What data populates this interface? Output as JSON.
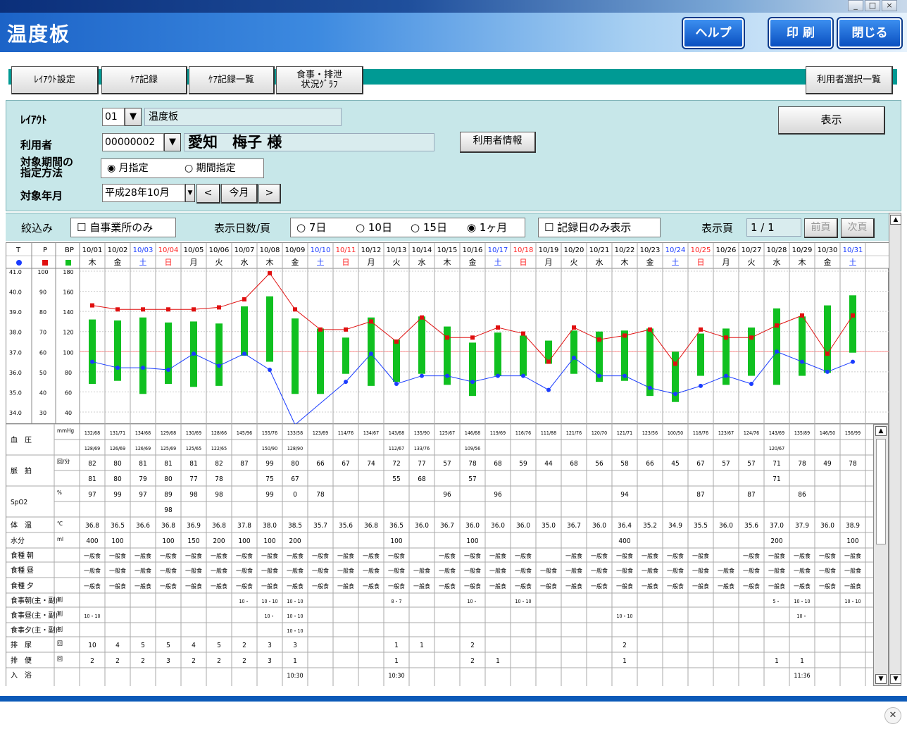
{
  "window": {
    "controls": [
      "_",
      "□",
      "×"
    ]
  },
  "header": {
    "title": "温度板",
    "help_button": "ヘルプ",
    "print_button": "印 刷",
    "close_button": "閉じる"
  },
  "tabs": [
    "ﾚｲｱｳﾄ設定",
    "ｹｱ記録",
    "ｹｱ記録一覧",
    "食事・排泄\n状況ｸﾞﾗﾌ"
  ],
  "user_select_button": "利用者選択一覧",
  "form": {
    "layout_label": "ﾚｲｱｳﾄ",
    "layout_code": "01",
    "layout_name": "温度板",
    "user_label": "利用者",
    "user_code": "00000002",
    "user_name": "愛知　梅子 様",
    "user_info_button": "利用者情報",
    "period_method_label": "対象期間の\n指定方法",
    "radio_month": "月指定",
    "radio_period": "期間指定",
    "target_month_label": "対象年月",
    "target_month_value": "平成28年10月",
    "prev_button": "<",
    "this_month_button": "今月",
    "next_button": ">",
    "display_button": "表示"
  },
  "filter": {
    "narrow_label": "絞込み",
    "own_office_only": "自事業所のみ",
    "days_per_page_label": "表示日数/頁",
    "opt_7": "7日",
    "opt_10": "10日",
    "opt_15": "15日",
    "opt_1m": "1ヶ月",
    "record_days_only": "記録日のみ表示",
    "page_label": "表示頁",
    "page_value": "1 / 1",
    "prev_page": "前頁",
    "next_page": "次頁"
  },
  "chart_data": {
    "type": "line",
    "axis_headers": {
      "t": "T",
      "p": "P",
      "bp": "BP"
    },
    "axis_t_ticks": [
      "41.0",
      "40.0",
      "39.0",
      "38.0",
      "37.0",
      "36.0",
      "35.0",
      "34.0"
    ],
    "axis_p_ticks": [
      "100",
      "90",
      "80",
      "70",
      "60",
      "50",
      "40",
      "30"
    ],
    "axis_bp_ticks": [
      "180",
      "160",
      "140",
      "120",
      "100",
      "80",
      "60",
      "40"
    ],
    "dates": [
      "10/01",
      "10/02",
      "10/03",
      "10/04",
      "10/05",
      "10/06",
      "10/07",
      "10/08",
      "10/09",
      "10/10",
      "10/11",
      "10/12",
      "10/13",
      "10/14",
      "10/15",
      "10/16",
      "10/17",
      "10/18",
      "10/19",
      "10/20",
      "10/21",
      "10/22",
      "10/23",
      "10/24",
      "10/25",
      "10/26",
      "10/27",
      "10/28",
      "10/29",
      "10/30",
      "10/31"
    ],
    "weekdays": [
      "木",
      "金",
      "土",
      "日",
      "月",
      "火",
      "水",
      "木",
      "金",
      "土",
      "日",
      "月",
      "火",
      "水",
      "木",
      "金",
      "土",
      "日",
      "月",
      "火",
      "水",
      "木",
      "金",
      "土",
      "日",
      "月",
      "火",
      "水",
      "木",
      "金",
      "土"
    ],
    "colors": {
      "saturday": "#1a3cff",
      "sunday": "#ff2020",
      "temp": "#1a3cff",
      "pulse": "#e01010",
      "bp": "#10c020",
      "baseline": "#ff9090"
    },
    "temperature": [
      36.8,
      36.5,
      36.6,
      36.8,
      36.9,
      36.8,
      37.8,
      38.0,
      38.5,
      35.7,
      35.6,
      36.8,
      36.5,
      36.0,
      36.7,
      36.0,
      36.0,
      36.0,
      35.0,
      36.7,
      36.0,
      36.4,
      35.2,
      34.9,
      35.5,
      36.0,
      35.6,
      37.0,
      37.9,
      36.0,
      38.9
    ],
    "temperature_plot": [
      36.5,
      36.2,
      36.2,
      36.1,
      36.9,
      36.3,
      36.9,
      36.1,
      33.0,
      null,
      35.5,
      36.9,
      35.4,
      35.8,
      35.8,
      35.5,
      35.8,
      35.8,
      35.1,
      36.7,
      35.8,
      35.8,
      35.2,
      34.9,
      35.3,
      35.8,
      35.4,
      37.0,
      36.5,
      36.0,
      36.5
    ],
    "pulse": [
      82,
      80,
      81,
      81,
      81,
      82,
      87,
      99,
      80,
      66,
      67,
      74,
      72,
      77,
      57,
      78,
      68,
      59,
      44,
      68,
      56,
      58,
      66,
      45,
      67,
      57,
      57,
      71,
      78,
      49,
      78
    ],
    "pulse_plot": [
      83,
      81,
      81,
      81,
      81,
      82,
      86,
      99,
      81,
      71,
      71,
      75,
      65,
      77,
      67,
      67,
      72,
      69,
      55,
      72,
      66,
      68,
      71,
      54,
      71,
      67,
      67,
      73,
      78,
      59,
      78
    ],
    "bp_high": [
      132,
      131,
      134,
      129,
      130,
      128,
      145,
      155,
      133,
      123,
      114,
      134,
      112,
      135,
      125,
      109,
      119,
      116,
      111,
      121,
      120,
      121,
      123,
      100,
      118,
      123,
      124,
      143,
      135,
      146,
      156
    ],
    "bp_low": [
      68,
      71,
      58,
      68,
      65,
      66,
      96,
      90,
      58,
      58,
      78,
      66,
      70,
      78,
      67,
      56,
      76,
      76,
      88,
      78,
      70,
      71,
      56,
      50,
      76,
      67,
      76,
      67,
      76,
      79,
      99
    ],
    "bp_high_text": [
      "132/68",
      "131/71",
      "134/68",
      "129/68",
      "130/69",
      "128/66",
      "145/96",
      "155/76",
      "133/58",
      "123/69",
      "114/76",
      "134/67",
      "143/68",
      "135/90",
      "125/67",
      "146/68",
      "119/69",
      "116/76",
      "111/88",
      "121/76",
      "120/70",
      "121/71",
      "123/56",
      "100/50",
      "118/76",
      "123/67",
      "124/76",
      "143/69",
      "135/89",
      "146/50",
      "156/99"
    ],
    "bp_low_text": [
      "128/69",
      "126/69",
      "126/69",
      "125/69",
      "125/65",
      "122/65",
      "",
      "150/90",
      "128/90",
      "",
      "",
      "",
      "112/67",
      "133/76",
      "",
      "109/56",
      "",
      "",
      "",
      "",
      "",
      "",
      "",
      "",
      "",
      "",
      "",
      "120/67",
      "",
      "",
      ""
    ],
    "ylim_temp": [
      34.0,
      41.0
    ]
  },
  "table": {
    "row_labels": [
      "血　圧",
      "",
      "脈　拍",
      "",
      "SpO2",
      "",
      "体　温",
      "水分",
      "食種 朝",
      "食種 昼",
      "食種 夕",
      "食事朝(主・副)",
      "食事昼(主・副)",
      "食事夕(主・副)",
      "排　尿",
      "排　便",
      "入　浴"
    ],
    "units": [
      "mmHg",
      "",
      "回/分",
      "",
      "%",
      "",
      "℃",
      "ml",
      "",
      "",
      "",
      "割",
      "割",
      "割",
      "回",
      "回",
      ""
    ],
    "pulse_row1": [
      "82",
      "80",
      "81",
      "81",
      "81",
      "82",
      "87",
      "99",
      "80",
      "66",
      "67",
      "74",
      "72",
      "77",
      "57",
      "78",
      "68",
      "59",
      "44",
      "68",
      "56",
      "58",
      "66",
      "45",
      "67",
      "57",
      "57",
      "71",
      "78",
      "49",
      "78"
    ],
    "pulse_row2": [
      "81",
      "80",
      "79",
      "80",
      "77",
      "78",
      "",
      "75",
      "67",
      "",
      "",
      "",
      "55",
      "68",
      "",
      "57",
      "",
      "",
      "",
      "",
      "",
      "",
      "",
      "",
      "",
      "",
      "",
      "71",
      "",
      "",
      ""
    ],
    "spo2_row1": [
      "97",
      "99",
      "97",
      "89",
      "98",
      "98",
      "",
      "99",
      "0",
      "78",
      "",
      "",
      "",
      "",
      "96",
      "",
      "96",
      "",
      "",
      "",
      "",
      "94",
      "",
      "",
      "87",
      "",
      "87",
      "",
      "86",
      "",
      ""
    ],
    "spo2_row2": [
      "",
      "",
      "",
      "98",
      "",
      "",
      "",
      "",
      "",
      "",
      "",
      "",
      "",
      "",
      "",
      "",
      "",
      "",
      "",
      "",
      "",
      "",
      "",
      "",
      "",
      "",
      "",
      "",
      "",
      "",
      ""
    ],
    "temp_row": [
      "36.8",
      "36.5",
      "36.6",
      "36.8",
      "36.9",
      "36.8",
      "37.8",
      "38.0",
      "38.5",
      "35.7",
      "35.6",
      "36.8",
      "36.5",
      "36.0",
      "36.7",
      "36.0",
      "36.0",
      "36.0",
      "35.0",
      "36.7",
      "36.0",
      "36.4",
      "35.2",
      "34.9",
      "35.5",
      "36.0",
      "35.6",
      "37.0",
      "37.9",
      "36.0",
      "38.9"
    ],
    "water_row": [
      "400",
      "100",
      "",
      "100",
      "150",
      "200",
      "100",
      "100",
      "200",
      "",
      "",
      "",
      "100",
      "",
      "",
      "100",
      "",
      "",
      "",
      "",
      "",
      "400",
      "",
      "",
      "",
      "",
      "",
      "200",
      "",
      "",
      "100"
    ],
    "meal_type": "一般食",
    "meal_morning_mask": [
      1,
      1,
      1,
      1,
      1,
      1,
      1,
      1,
      1,
      1,
      1,
      1,
      1,
      0,
      1,
      1,
      1,
      1,
      0,
      1,
      1,
      1,
      1,
      1,
      1,
      0,
      1,
      1,
      1,
      1,
      1
    ],
    "meal_noon_mask": [
      1,
      1,
      1,
      1,
      1,
      1,
      1,
      1,
      1,
      1,
      1,
      1,
      1,
      1,
      1,
      1,
      1,
      1,
      1,
      1,
      1,
      1,
      1,
      1,
      1,
      1,
      1,
      1,
      1,
      1,
      1
    ],
    "meal_eve_mask": [
      1,
      1,
      1,
      1,
      1,
      1,
      1,
      1,
      1,
      1,
      1,
      1,
      1,
      1,
      1,
      1,
      1,
      1,
      1,
      1,
      1,
      1,
      1,
      1,
      1,
      1,
      1,
      1,
      1,
      1,
      1
    ],
    "meal_am_row": [
      "",
      "",
      "",
      "",
      "",
      "",
      "10・",
      "10・10",
      "10・10",
      "",
      "",
      "",
      "8・7",
      "",
      "",
      "10・",
      "",
      "10・10",
      "",
      "",
      "",
      "",
      "",
      "",
      "",
      "",
      "",
      "5・",
      "10・10",
      "",
      "10・10"
    ],
    "meal_noon_row": [
      "10・10",
      "",
      "",
      "",
      "",
      "",
      "",
      "10・",
      "10・10",
      "",
      "",
      "",
      "",
      "",
      "",
      "",
      "",
      "",
      "",
      "",
      "",
      "10・10",
      "",
      "",
      "",
      "",
      "",
      "",
      "10・",
      "",
      ""
    ],
    "meal_eve_row": [
      "",
      "",
      "",
      "",
      "",
      "",
      "",
      "",
      "10・10",
      "",
      "",
      "",
      "",
      "",
      "",
      "",
      "",
      "",
      "",
      "",
      "",
      "",
      "",
      "",
      "",
      "",
      "",
      "",
      "",
      "",
      ""
    ],
    "urine_row": [
      "10",
      "4",
      "5",
      "5",
      "4",
      "5",
      "2",
      "3",
      "3",
      "",
      "",
      "",
      "1",
      "1",
      "",
      "2",
      "",
      "",
      "",
      "",
      "",
      "2",
      "",
      "",
      "",
      "",
      "",
      "",
      "",
      "",
      ""
    ],
    "stool_row": [
      "2",
      "2",
      "2",
      "3",
      "2",
      "2",
      "2",
      "3",
      "1",
      "",
      "",
      "",
      "1",
      "",
      "",
      "2",
      "1",
      "",
      "",
      "",
      "",
      "1",
      "",
      "",
      "",
      "",
      "",
      "1",
      "1",
      "",
      ""
    ],
    "bath_row": [
      "",
      "",
      "",
      "",
      "",
      "",
      "",
      "",
      "10:30",
      "",
      "",
      "",
      "10:30",
      "",
      "",
      "",
      "",
      "",
      "",
      "",
      "",
      "",
      "",
      "",
      "",
      "",
      "",
      "",
      "11:36",
      "",
      ""
    ]
  }
}
